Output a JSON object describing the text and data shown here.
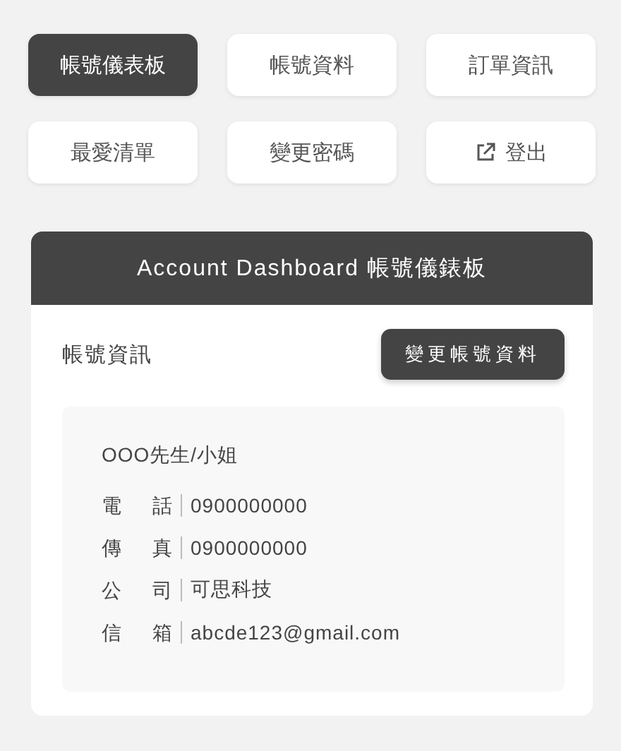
{
  "menu": [
    {
      "label": "帳號儀表板",
      "selected": true,
      "kind": "page"
    },
    {
      "label": "帳號資料",
      "selected": false,
      "kind": "page"
    },
    {
      "label": "訂單資訊",
      "selected": false,
      "kind": "page"
    },
    {
      "label": "最愛清單",
      "selected": false,
      "kind": "page"
    },
    {
      "label": "變更密碼",
      "selected": false,
      "kind": "page"
    },
    {
      "label": "登出",
      "selected": false,
      "kind": "exit"
    }
  ],
  "card": {
    "title": "Account Dashboard 帳號儀錶板",
    "section_title": "帳號資訊",
    "edit_button": "變更帳號資料",
    "name": "OOO先生/小姐",
    "fields": [
      {
        "label": "電話",
        "value": "0900000000"
      },
      {
        "label": "傳真",
        "value": "0900000000"
      },
      {
        "label": "公司",
        "value": "可思科技"
      },
      {
        "label": "信箱",
        "value": "abcde123@gmail.com"
      }
    ]
  }
}
